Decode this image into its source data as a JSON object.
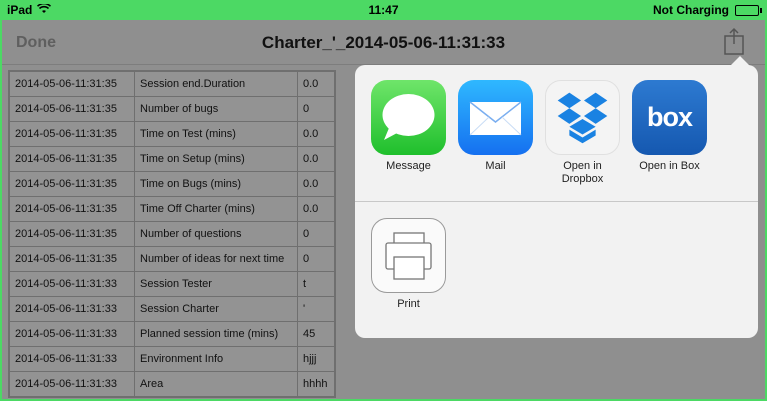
{
  "status": {
    "device": "iPad",
    "time": "11:47",
    "charging": "Not Charging"
  },
  "nav": {
    "done_label": "Done",
    "title": "Charter_'_2014-05-06-11:31:33"
  },
  "table": {
    "rows": [
      [
        "2014-05-06-11:31:35",
        "Session end.Duration",
        "0.0"
      ],
      [
        "2014-05-06-11:31:35",
        "Number of bugs",
        "0"
      ],
      [
        "2014-05-06-11:31:35",
        "Time on Test (mins)",
        "0.0"
      ],
      [
        "2014-05-06-11:31:35",
        "Time on Setup (mins)",
        "0.0"
      ],
      [
        "2014-05-06-11:31:35",
        "Time on Bugs (mins)",
        "0.0"
      ],
      [
        "2014-05-06-11:31:35",
        "Time Off Charter (mins)",
        "0.0"
      ],
      [
        "2014-05-06-11:31:35",
        "Number of questions",
        "0"
      ],
      [
        "2014-05-06-11:31:35",
        "Number of ideas for next time",
        "0"
      ],
      [
        "2014-05-06-11:31:33",
        "Session Tester",
        "t"
      ],
      [
        "2014-05-06-11:31:33",
        "Session Charter",
        "'"
      ],
      [
        "2014-05-06-11:31:33",
        "Planned session time (mins)",
        "45"
      ],
      [
        "2014-05-06-11:31:33",
        "Environment Info",
        "hjjj"
      ],
      [
        "2014-05-06-11:31:33",
        "Area",
        "hhhh"
      ]
    ]
  },
  "share": {
    "apps": [
      {
        "label": "Message",
        "icon": "message-icon"
      },
      {
        "label": "Mail",
        "icon": "mail-icon"
      },
      {
        "label": "Open in Dropbox",
        "icon": "dropbox-icon"
      },
      {
        "label": "Open in Box",
        "icon": "box-icon",
        "icon_text": "box"
      }
    ],
    "actions": [
      {
        "label": "Print",
        "icon": "print-icon"
      }
    ]
  }
}
